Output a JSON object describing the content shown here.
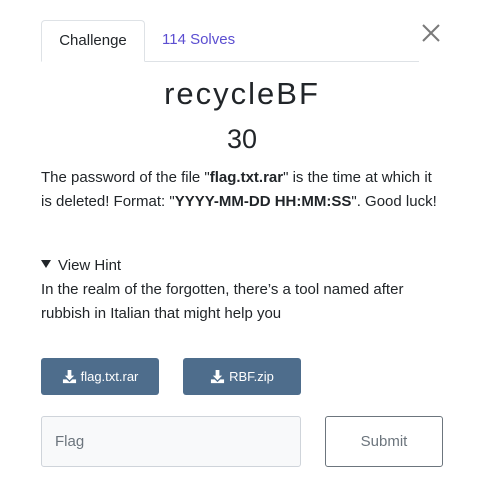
{
  "tabs": {
    "challenge_label": "Challenge",
    "solves_label": "114 Solves"
  },
  "challenge": {
    "name": "recycleBF",
    "points": "30",
    "description": {
      "part1": "The password of the file \"",
      "filename": "flag.txt.rar",
      "part2": "\" is the time at which it is deleted! Format: \"",
      "format": "YYYY-MM-DD HH:MM:SS",
      "part3": "\". Good luck!"
    }
  },
  "hint": {
    "summary": "View Hint",
    "body": "In the realm of the forgotten, there’s a tool named after rubbish in Italian that might help you"
  },
  "files": [
    {
      "label": "flag.txt.rar",
      "icon": "download-icon"
    },
    {
      "label": "RBF.zip",
      "icon": "download-icon"
    }
  ],
  "submission": {
    "placeholder": "Flag",
    "value": "",
    "submit_label": "Submit"
  },
  "colors": {
    "accent": "#5b4ed1",
    "file_button": "#4e6d8c",
    "text": "#212529",
    "muted": "#6c757d"
  }
}
